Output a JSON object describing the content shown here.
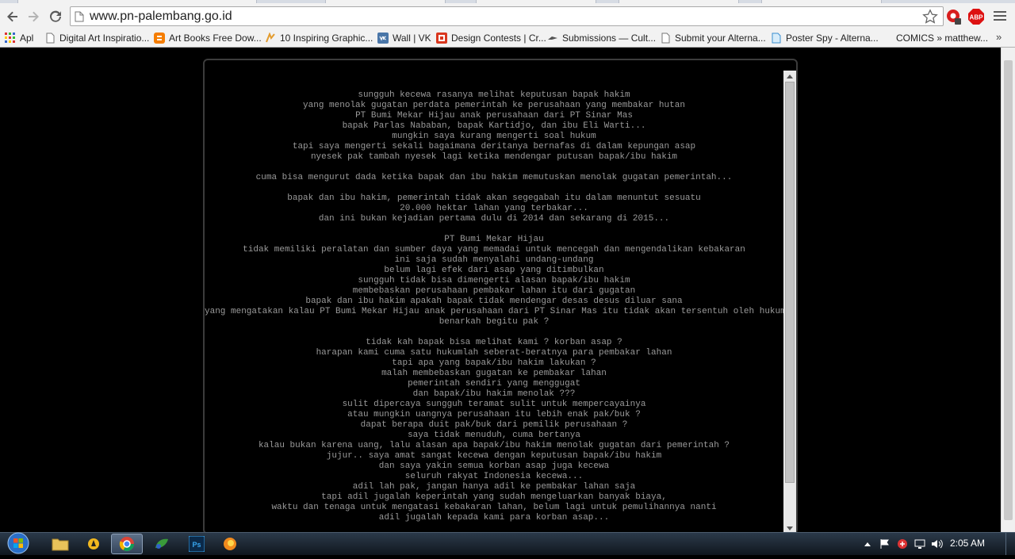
{
  "browser": {
    "url": "www.pn-palembang.go.id",
    "bookmarks": [
      {
        "label": "Apl",
        "icon": "apps-grid-icon"
      },
      {
        "label": "Digital Art Inspiratio...",
        "icon": "page-icon"
      },
      {
        "label": "Art Books Free Dow...",
        "icon": "blogger-icon"
      },
      {
        "label": "10 Inspiring Graphic...",
        "icon": "behance-icon"
      },
      {
        "label": "Wall | VK",
        "icon": "vk-icon"
      },
      {
        "label": "Design Contests | Cr...",
        "icon": "contest-icon"
      },
      {
        "label": "Submissions — Cult...",
        "icon": "cult-icon"
      },
      {
        "label": "Submit your Alterna...",
        "icon": "page-icon"
      },
      {
        "label": "Poster Spy - Alterna...",
        "icon": "posterspy-icon"
      },
      {
        "label": "COMICS » matthew...",
        "icon": "none"
      }
    ],
    "bookmarks_more": "»",
    "ext_abp_label": "ABP"
  },
  "content": {
    "lines": [
      "sungguh kecewa rasanya melihat keputusan bapak hakim",
      "yang menolak gugatan perdata pemerintah ke perusahaan yang membakar hutan",
      "PT Bumi Mekar Hijau anak perusahaan dari PT Sinar Mas",
      "bapak Parlas Nababan, bapak Kartidjo, dan ibu Eli Warti...",
      "mungkin saya kurang mengerti soal hukum",
      "tapi saya mengerti sekali bagaimana deritanya bernafas di dalam kepungan asap",
      "nyesek pak tambah nyesek lagi ketika mendengar putusan bapak/ibu hakim",
      "",
      "cuma bisa mengurut dada ketika bapak dan ibu hakim memutuskan menolak gugatan pemerintah...",
      "",
      "bapak dan ibu hakim, pemerintah tidak akan segegabah itu dalam menuntut sesuatu",
      "20.000 hektar lahan yang terbakar...",
      "dan ini bukan kejadian pertama dulu di 2014 dan sekarang di 2015...",
      "",
      "PT Bumi Mekar Hijau",
      "tidak memiliki peralatan dan sumber daya yang memadai untuk mencegah dan mengendalikan kebakaran",
      "ini saja sudah menyalahi undang-undang",
      "belum lagi efek dari asap yang ditimbulkan",
      "sungguh tidak bisa dimengerti alasan bapak/ibu hakim",
      "membebaskan perusahaan pembakar lahan itu dari gugatan",
      "bapak dan ibu hakim apakah bapak tidak mendengar desas desus diluar sana",
      "yang mengatakan kalau PT Bumi Mekar Hijau anak perusahaan dari PT Sinar Mas itu tidak akan tersentuh oleh hukum ?",
      "benarkah begitu pak ?",
      "",
      "tidak kah bapak bisa melihat kami ? korban asap ?",
      "harapan kami cuma satu hukumlah seberat-beratnya para pembakar lahan",
      "tapi apa yang bapak/ibu hakim lakukan ?",
      "malah membebaskan gugatan ke pembakar lahan",
      "pemerintah sendiri yang menggugat",
      "dan bapak/ibu hakim menolak ???",
      "sulit dipercaya sungguh teramat sulit untuk mempercayainya",
      "atau mungkin uangnya perusahaan itu lebih enak pak/buk ?",
      "dapat berapa duit pak/buk dari pemilik perusahaan ?",
      "saya tidak menuduh, cuma bertanya",
      "kalau bukan karena uang, lalu alasan apa bapak/ibu hakim menolak gugatan dari pemerintah ?",
      "jujur.. saya amat sangat kecewa dengan keputusan bapak/ibu hakim",
      "dan saya yakin semua korban asap juga kecewa",
      "seluruh rakyat Indonesia kecewa...",
      "adil lah pak, jangan hanya adil ke pembakar lahan saja",
      "tapi adil jugalah keperintah yang sudah mengeluarkan banyak biaya,",
      "waktu dan tenaga untuk mengatasi kebakaran lahan, belum lagi untuk pemulihannya nanti",
      "adil jugalah kepada kami para korban asap..."
    ]
  },
  "taskbar": {
    "clock": "2:05 AM",
    "ps_label": "Ps"
  }
}
